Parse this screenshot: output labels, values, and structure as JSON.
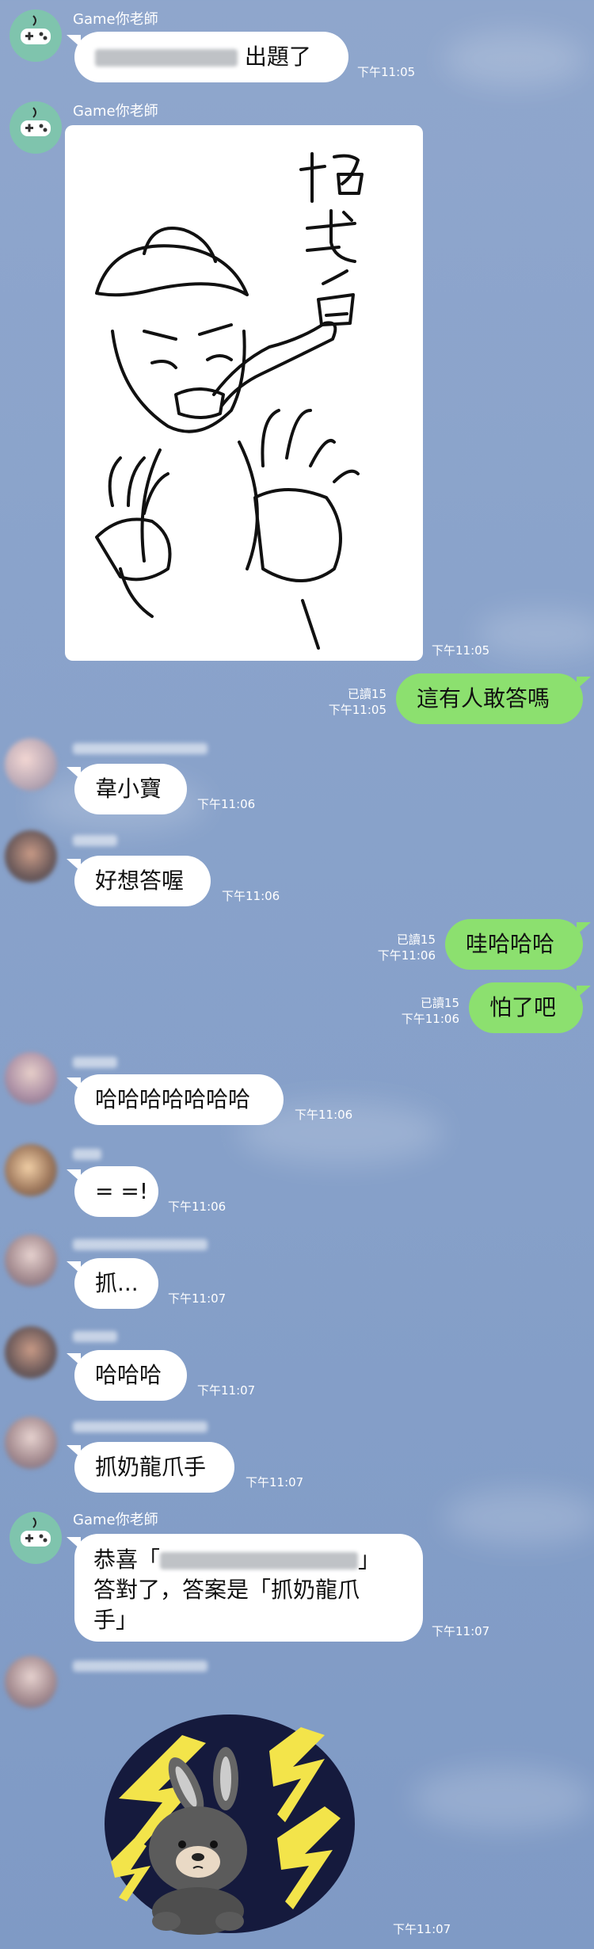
{
  "bot_name": "Game你老師",
  "messages": {
    "m1": {
      "text": "出題了",
      "time": "下午11:05"
    },
    "m2": {
      "image": "hand-drawn sketch",
      "caption": "招式名",
      "time": "下午11:05"
    },
    "m3": {
      "text": "這有人敢答嗎",
      "read": "已讀15",
      "time": "下午11:05"
    },
    "m4": {
      "text": "韋小寶",
      "time": "下午11:06"
    },
    "m5": {
      "text": "好想答喔",
      "time": "下午11:06"
    },
    "m6": {
      "text": "哇哈哈哈",
      "read": "已讀15",
      "time": "下午11:06"
    },
    "m7": {
      "text": "怕了吧",
      "read": "已讀15",
      "time": "下午11:06"
    },
    "m8": {
      "text": "哈哈哈哈哈哈哈",
      "time": "下午11:06"
    },
    "m9": {
      "text": "= =!",
      "time": "下午11:06"
    },
    "m10": {
      "text": "抓...",
      "time": "下午11:07"
    },
    "m11": {
      "text": "哈哈哈",
      "time": "下午11:07"
    },
    "m12": {
      "text": "抓奶龍爪手",
      "time": "下午11:07"
    },
    "m13": {
      "line1_a": "恭喜「",
      "line1_b": "」",
      "line2": "答對了，答案是「抓奶龍爪",
      "line3": "手」",
      "time": "下午11:07"
    },
    "m14": {
      "sticker": "brown-bear-sticker",
      "time": "下午11:07"
    }
  },
  "colors": {
    "background": "#8aa3cb",
    "incoming_bubble": "#ffffff",
    "outgoing_bubble": "#8ce06f",
    "bot_avatar": "#7fc4ad"
  }
}
